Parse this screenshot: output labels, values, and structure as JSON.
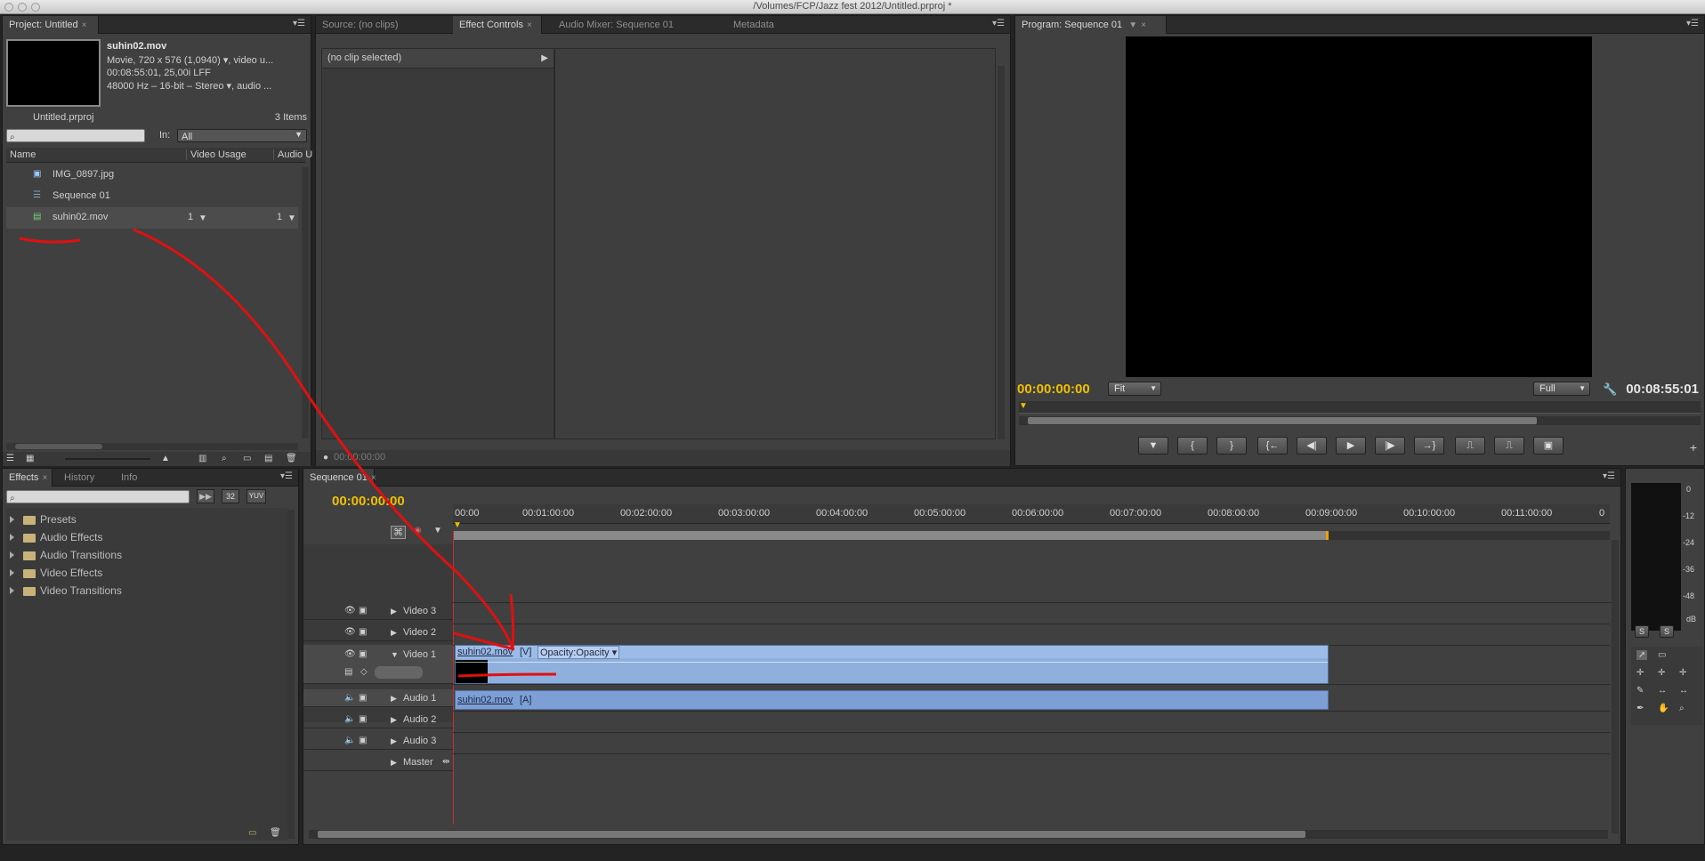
{
  "window": {
    "title": "/Volumes/FCP/Jazz fest 2012/Untitled.prproj *"
  },
  "project": {
    "tab": "Project: Untitled",
    "clip_name": "suhin02.mov",
    "info_line1": "Movie, 720 x 576 (1,0940)",
    "info_line1_suffix": ", video u...",
    "info_line2": "00:08:55:01, 25,00i LFF",
    "info_line3": "48000 Hz – 16-bit – Stereo",
    "info_line3_suffix": ", audio ...",
    "project_file": "Untitled.prproj",
    "item_count": "3 Items",
    "in_label": "In:",
    "in_value": "All",
    "columns": {
      "name": "Name",
      "video_usage": "Video Usage",
      "audio": "Audio U"
    },
    "items": [
      {
        "name": "IMG_0897.jpg",
        "video_usage": "",
        "audio_usage": ""
      },
      {
        "name": "Sequence 01",
        "video_usage": "",
        "audio_usage": ""
      },
      {
        "name": "suhin02.mov",
        "video_usage": "1",
        "audio_usage": "1"
      }
    ]
  },
  "source_panel": {
    "tabs": [
      "Source: (no clips)",
      "Effect Controls",
      "Audio Mixer: Sequence 01",
      "Metadata"
    ],
    "no_clip": "(no clip selected)",
    "timecode": "00:00:00:00"
  },
  "program": {
    "tab": "Program: Sequence 01",
    "timecode_current": "00:00:00:00",
    "fit": "Fit",
    "quality": "Full",
    "timecode_duration": "00:08:55:01"
  },
  "effects": {
    "tabs": [
      "Effects",
      "History",
      "Info"
    ],
    "badges": [
      "32",
      "YUV"
    ],
    "folders": [
      "Presets",
      "Audio Effects",
      "Audio Transitions",
      "Video Effects",
      "Video Transitions"
    ]
  },
  "timeline": {
    "tab": "Sequence 01",
    "timecode": "00:00:00:00",
    "ruler": [
      "00:00",
      "00:01:00:00",
      "00:02:00:00",
      "00:03:00:00",
      "00:04:00:00",
      "00:05:00:00",
      "00:06:00:00",
      "00:07:00:00",
      "00:08:00:00",
      "00:09:00:00",
      "00:10:00:00",
      "00:11:00:00",
      "0"
    ],
    "tracks": {
      "v3": "Video 3",
      "v2": "Video 2",
      "v1": "Video 1",
      "a1": "Audio 1",
      "a2": "Audio 2",
      "a3": "Audio 3",
      "master": "Master"
    },
    "video_clip": {
      "name": "suhin02.mov",
      "tag": "[V]",
      "effect": "Opacity:Opacity"
    },
    "audio_clip": {
      "name": "suhin02.mov",
      "tag": "[A]"
    }
  },
  "meter": {
    "labels": [
      "0",
      "-12",
      "-24",
      "-36",
      "-48",
      "dB"
    ],
    "solo": [
      "S",
      "S"
    ]
  },
  "colors": {
    "timecode": "#f0c000",
    "annotation": "#e01010",
    "clip": "#8fb0dd"
  }
}
